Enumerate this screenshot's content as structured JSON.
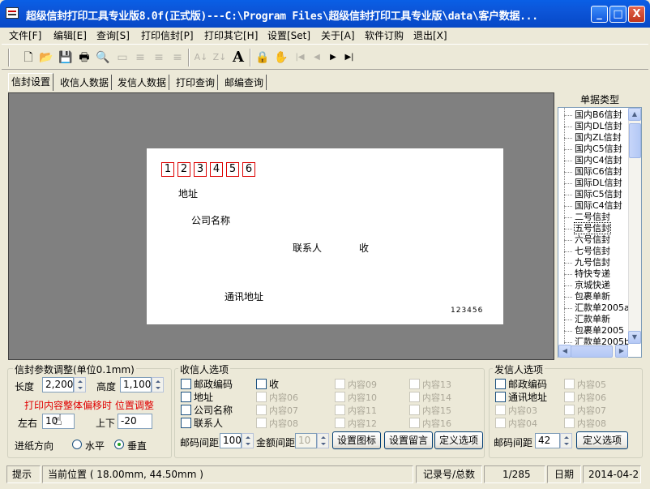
{
  "window": {
    "title": "超级信封打印工具专业版8.0f(正式版)---C:\\Program Files\\超级信封打印工具专业版\\data\\客户数据...",
    "minimize": "_",
    "maximize": "□",
    "close": "X"
  },
  "menu": [
    "文件[F]",
    "编辑[E]",
    "查询[S]",
    "打印信封[P]",
    "打印其它[H]",
    "设置[Set]",
    "关于[A]",
    "软件订购",
    "退出[X]"
  ],
  "toolbar_icons": [
    "new-file-icon",
    "open-folder-icon",
    "save-icon",
    "print-icon",
    "print-preview-icon",
    "ruler-icon",
    "align-left-icon",
    "align-center-icon",
    "align-right-icon",
    "sort-asc-icon",
    "sort-desc-icon",
    "font-icon",
    "lock-icon",
    "hand-icon",
    "first-record-icon",
    "prev-record-icon",
    "next-record-icon",
    "last-record-icon"
  ],
  "tabs": [
    "信封设置",
    "收信人数据",
    "发信人数据",
    "打印查询",
    "邮编查询"
  ],
  "envelope": {
    "zip_digits": [
      "1",
      "2",
      "3",
      "4",
      "5",
      "6"
    ],
    "address": "地址",
    "company": "公司名称",
    "contact": "联系人",
    "receive": "收",
    "sender_address": "通讯地址",
    "sender_zip": "123456"
  },
  "doc_types": {
    "title": "单据类型",
    "items": [
      "国内B6信封",
      "国内DL信封",
      "国内ZL信封",
      "国内C5信封",
      "国内C4信封",
      "国际C6信封",
      "国际DL信封",
      "国际C5信封",
      "国际C4信封",
      "二号信封",
      "五号信封",
      "六号信封",
      "七号信封",
      "九号信封",
      "特快专递",
      "京城快递",
      "包裹单新",
      "汇款单2005a",
      "汇款单新",
      "包裹单2005",
      "汇款单2005b"
    ],
    "selected": "五号信封"
  },
  "params": {
    "title": "信封参数调整(单位0.1mm)",
    "length_label": "长度",
    "length_value": "2,200",
    "height_label": "高度",
    "height_value": "1,100",
    "offset_note": "打印内容整体偏移时  位置调整",
    "lr_label": "左右",
    "lr_value": "10",
    "ud_label": "上下",
    "ud_value": "-20",
    "feed_label": "进纸方向",
    "feed_horizontal": "水平",
    "feed_vertical": "垂直",
    "feed_selected": "垂直"
  },
  "recipient": {
    "title": "收信人选项",
    "col1": [
      "邮政编码",
      "地址",
      "公司名称",
      "联系人"
    ],
    "col2": [
      "收",
      "内容06",
      "内容07",
      "内容08"
    ],
    "col3": [
      "内容09",
      "内容10",
      "内容11",
      "内容12"
    ],
    "col4": [
      "内容13",
      "内容14",
      "内容15",
      "内容16"
    ],
    "zip_spacing_label": "邮码间距",
    "zip_spacing_value": "100",
    "amount_spacing_label": "金额间距",
    "amount_spacing_value": "10",
    "btn_icon": "设置图标",
    "btn_message": "设置留言",
    "btn_define": "定义选项"
  },
  "sender": {
    "title": "发信人选项",
    "col1": [
      "邮政编码",
      "通讯地址",
      "内容03",
      "内容04"
    ],
    "col2": [
      "内容05",
      "内容06",
      "内容07",
      "内容08"
    ],
    "zip_spacing_label": "邮码间距",
    "zip_spacing_value": "42",
    "btn_define": "定义选项"
  },
  "status": {
    "hint": "提示",
    "position": "当前位置 (   18.00mm, 44.50mm   )",
    "record_label": "记录号/总数",
    "record_value": "1/285",
    "date_label": "日期",
    "date_value": "2014-04-2"
  }
}
